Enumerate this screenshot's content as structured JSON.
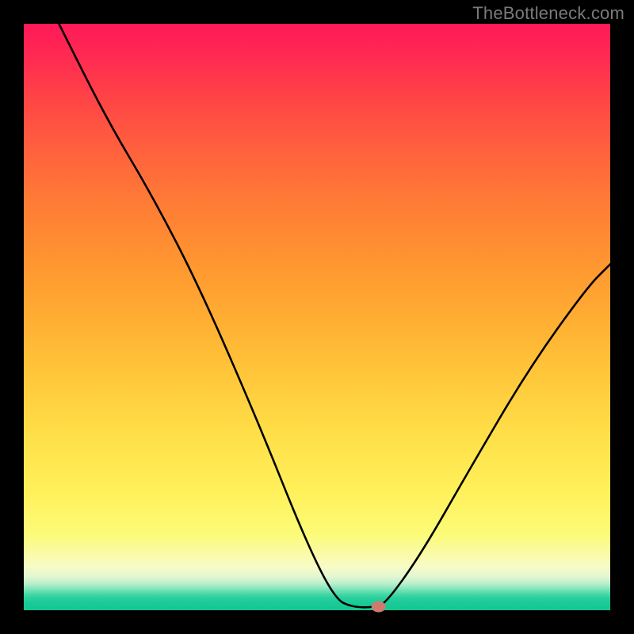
{
  "header": {
    "watermark": "TheBottleneck.com"
  },
  "chart_data": {
    "type": "line",
    "title": "",
    "xlabel": "",
    "ylabel": "",
    "xlim": [
      0,
      100
    ],
    "ylim": [
      0,
      100
    ],
    "series": [
      {
        "name": "bottleneck-curve",
        "points": [
          {
            "x": 6,
            "y": 100
          },
          {
            "x": 14,
            "y": 84
          },
          {
            "x": 22,
            "y": 70.5
          },
          {
            "x": 30,
            "y": 55
          },
          {
            "x": 40,
            "y": 32
          },
          {
            "x": 48,
            "y": 12
          },
          {
            "x": 53,
            "y": 2
          },
          {
            "x": 56,
            "y": 0.5
          },
          {
            "x": 60,
            "y": 0.5
          },
          {
            "x": 62,
            "y": 1.5
          },
          {
            "x": 68,
            "y": 10
          },
          {
            "x": 76,
            "y": 24
          },
          {
            "x": 86,
            "y": 41
          },
          {
            "x": 96,
            "y": 55
          },
          {
            "x": 100,
            "y": 59
          }
        ]
      }
    ],
    "marker": {
      "x": 60.5,
      "y": 0.6,
      "color": "#cf7a6e"
    }
  }
}
